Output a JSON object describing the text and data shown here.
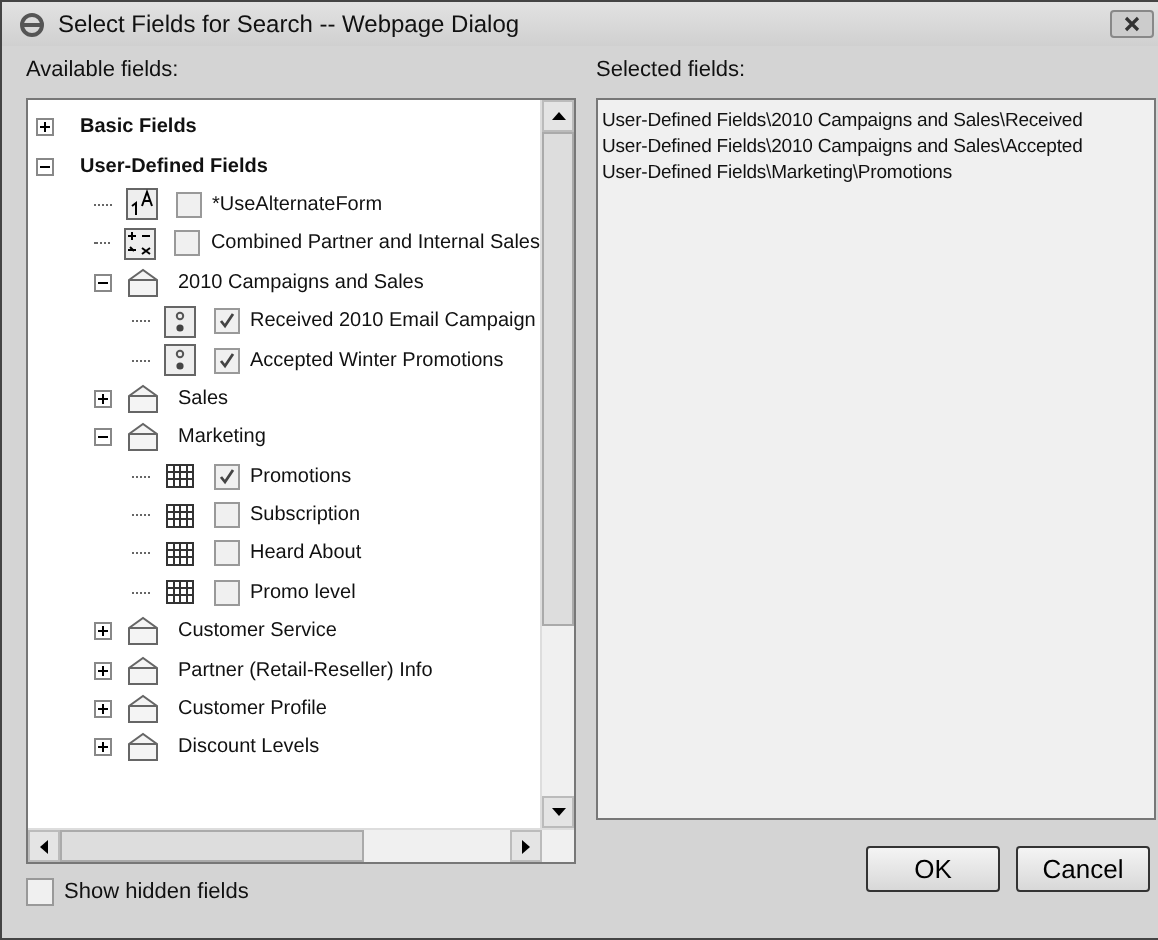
{
  "window": {
    "title": "Select Fields for Search -- Webpage Dialog"
  },
  "available_label": "Available fields:",
  "tree": [
    {
      "kind": "root",
      "label": "Basic Fields",
      "expanded": false
    },
    {
      "kind": "root",
      "label": "User-Defined Fields",
      "expanded": true,
      "children": [
        {
          "kind": "text-field",
          "label": "*UseAlternateForm",
          "checked": false
        },
        {
          "kind": "calc-field",
          "label": "Combined Partner and Internal Sales",
          "checked": false
        },
        {
          "kind": "folder",
          "label": "2010 Campaigns and Sales",
          "expanded": true,
          "children": [
            {
              "kind": "option-field",
              "label": "Received 2010 Email Campaign",
              "checked": true
            },
            {
              "kind": "option-field",
              "label": "Accepted Winter Promotions",
              "checked": true
            }
          ]
        },
        {
          "kind": "folder",
          "label": "Sales",
          "expanded": false
        },
        {
          "kind": "folder",
          "label": "Marketing",
          "expanded": true,
          "children": [
            {
              "kind": "grid-field",
              "label": "Promotions",
              "checked": true
            },
            {
              "kind": "grid-field",
              "label": "Subscription",
              "checked": false
            },
            {
              "kind": "grid-field",
              "label": "Heard About",
              "checked": false
            },
            {
              "kind": "grid-field",
              "label": "Promo level",
              "checked": false
            }
          ]
        },
        {
          "kind": "folder",
          "label": "Customer Service",
          "expanded": false
        },
        {
          "kind": "folder",
          "label": "Partner (Retail-Reseller) Info",
          "expanded": false
        },
        {
          "kind": "folder",
          "label": "Customer Profile",
          "expanded": false
        },
        {
          "kind": "folder",
          "label": "Discount Levels",
          "expanded": false
        }
      ]
    }
  ],
  "selected_label": "Selected fields:",
  "selected_fields": [
    "User-Defined Fields\\2010 Campaigns and Sales\\Received",
    "User-Defined Fields\\2010 Campaigns and Sales\\Accepted",
    "User-Defined Fields\\Marketing\\Promotions"
  ],
  "show_hidden": {
    "label": "Show hidden fields",
    "checked": false
  },
  "buttons": [
    "OK",
    "Cancel"
  ]
}
